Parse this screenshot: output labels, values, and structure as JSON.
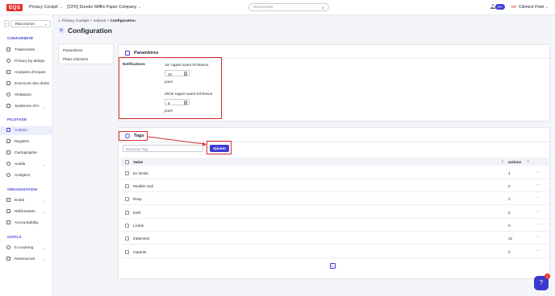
{
  "app": {
    "logo": "EQS",
    "menu1": "Privacy Cockpit",
    "menu2": "[CPO] Dunder Mifflin Paper Company",
    "search_placeholder": "Rechercher",
    "notif_badge": "99+",
    "user_initials": "CP",
    "user_name": "Clément Potel"
  },
  "sidebar": {
    "shortcuts": "Raccourcis",
    "sections": [
      {
        "title": "CONFORMITÉ",
        "items": [
          "Traitements",
          "Privacy by design",
          "Analyses d'impact",
          "Exercices des droits",
          "Violations",
          "Systèmes d'IA"
        ]
      },
      {
        "title": "PILOTAGE",
        "items": [
          "Actions",
          "Registre",
          "Cartographie",
          "Audits",
          "Analytics"
        ]
      },
      {
        "title": "ORGANISATION",
        "items": [
          "Entité",
          "Référentiels",
          "Accountability"
        ]
      },
      {
        "title": "OUTILS",
        "items": [
          "E-Learning",
          "Ressources"
        ]
      }
    ]
  },
  "breadcrumb": [
    "Privacy Cockpit",
    "Actions",
    "Configuration"
  ],
  "page_title": "Configuration",
  "tabs": [
    "Paramètres",
    "Plans d'actions"
  ],
  "params": {
    "title": "Paramètres",
    "notifications_label": "Notifications",
    "reminder1_label": "1er rappel avant échéance",
    "reminder1_value": "10",
    "reminder2_label": "2ème rappel avant échéance",
    "reminder2_value": "5",
    "unit": "jours"
  },
  "tags": {
    "title": "Tags",
    "input_placeholder": "Nouveau Tag",
    "add_label": "Ajouter",
    "col_value": "Value",
    "col_actions": "actions",
    "rows": [
      {
        "value": "Ex Droits",
        "count": "4"
      },
      {
        "value": "Modèle mail",
        "count": "2"
      },
      {
        "value": "Resp",
        "count": "2"
      },
      {
        "value": "DSR",
        "count": "2"
      },
      {
        "value": "Licéité",
        "count": "0"
      },
      {
        "value": "traitement",
        "count": "12"
      },
      {
        "value": "matériel",
        "count": "0"
      }
    ],
    "page": "1"
  },
  "help_badge": "1",
  "colors": {
    "accent": "#3f3cd6",
    "highlight": "#d92b2b",
    "brand": "#e5322d"
  }
}
